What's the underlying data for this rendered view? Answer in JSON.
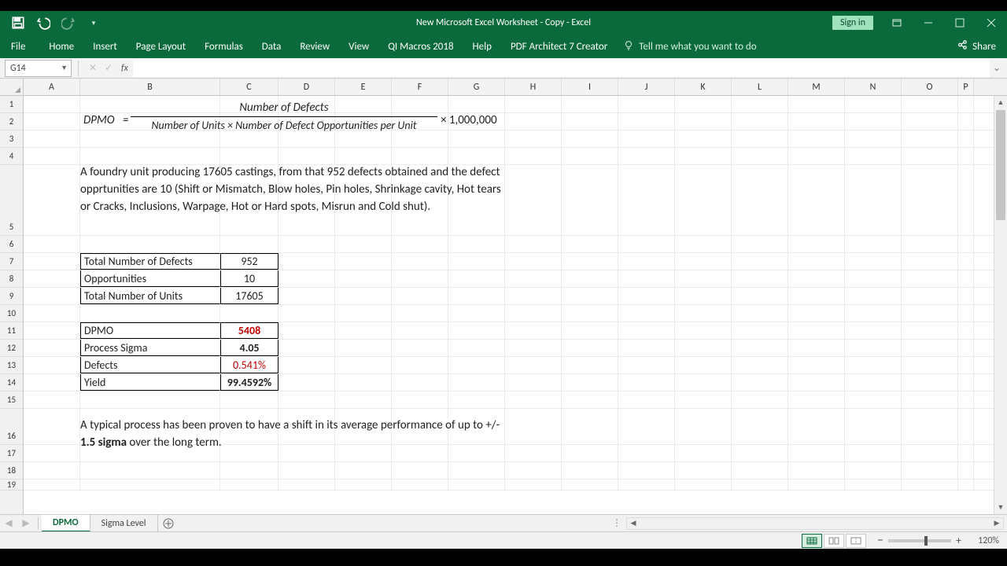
{
  "window": {
    "title": "New Microsoft Excel Worksheet - Copy  -  Excel",
    "signin": "Sign in"
  },
  "ribbon": {
    "file": "File",
    "tabs": [
      "Home",
      "Insert",
      "Page Layout",
      "Formulas",
      "Data",
      "Review",
      "View",
      "QI Macros 2018",
      "Help",
      "PDF Architect 7 Creator"
    ],
    "tellme": "Tell me what you want to do",
    "share": "Share"
  },
  "namebox": "G14",
  "fx_label": "fx",
  "columns": [
    "A",
    "B",
    "C",
    "D",
    "E",
    "F",
    "G",
    "H",
    "I",
    "J",
    "K",
    "L",
    "M",
    "N",
    "O",
    "P"
  ],
  "rows": [
    "1",
    "2",
    "3",
    "4",
    "5",
    "6",
    "7",
    "8",
    "9",
    "10",
    "11",
    "12",
    "13",
    "14",
    "15",
    "16",
    "17",
    "18",
    "19"
  ],
  "formula": {
    "lhs": "DPMO",
    "eq": "=",
    "numerator": "Number of Defects",
    "denominator": "Number of Units × Number of Defect Opportunities per Unit",
    "suffix": "× 1,000,000"
  },
  "description": "A foundry unit producing 17605 castings, from that 952 defects obtained and the defect opprtunities are 10 (Shift or Mismatch, Blow holes, Pin holes, Shrinkage cavity, Hot tears or Cracks, Inclusions, Warpage, Hot or Hard spots, Misrun and Cold shut).",
  "table1": {
    "rows": [
      {
        "label": "Total Number of Defects",
        "value": "952"
      },
      {
        "label": "Opportunities",
        "value": "10"
      },
      {
        "label": "Total Number of Units",
        "value": "17605"
      }
    ]
  },
  "table2": {
    "rows": [
      {
        "label": "DPMO",
        "value": "5408",
        "style": "red"
      },
      {
        "label": "Process Sigma",
        "value": "4.05",
        "style": "bold"
      },
      {
        "label": "Defects",
        "value": "0.541%",
        "style": "red"
      },
      {
        "label": "Yield",
        "value": "99.4592%",
        "style": "bold"
      }
    ]
  },
  "note_pre": "A typical process has been proven to have a shift in its average performance of up to +/- ",
  "note_bold": "1.5 sigma",
  "note_post": " over the long term.",
  "sheets": {
    "active": "DPMO",
    "other": "Sigma Level"
  },
  "status": {
    "ready": "",
    "zoom": "120%"
  }
}
